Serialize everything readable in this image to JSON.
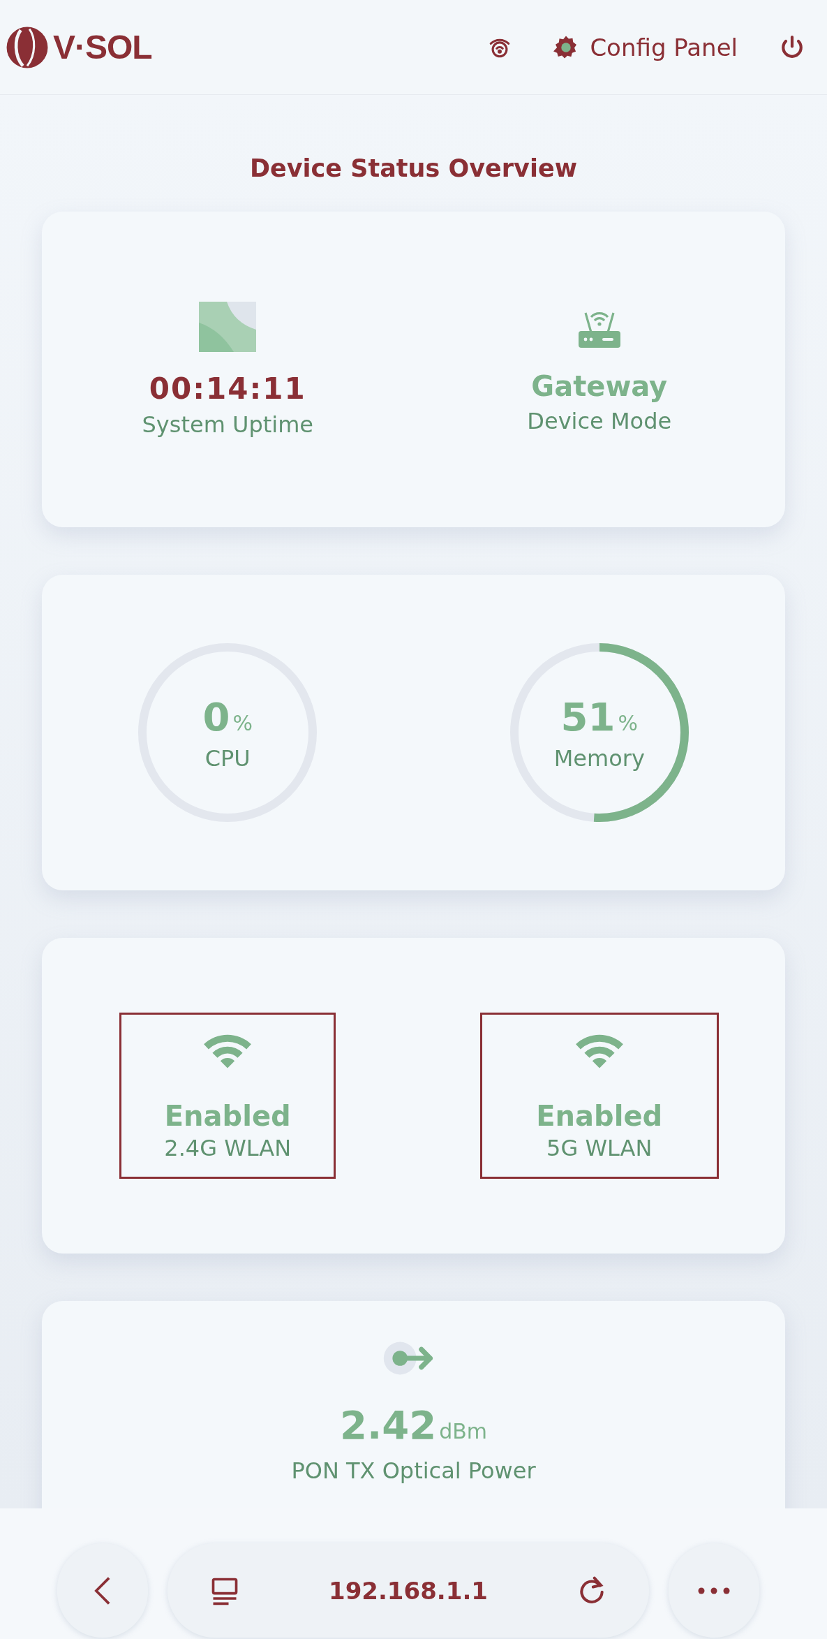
{
  "header": {
    "brand": "V·SOL",
    "config_label": "Config Panel"
  },
  "page_title": "Device Status Overview",
  "info_card": {
    "items": [
      {
        "kind": "uptime",
        "value": "00:14:11",
        "label": "System Uptime"
      },
      {
        "kind": "mode",
        "value": "Gateway",
        "label": "Device Mode"
      }
    ]
  },
  "usage_card": {
    "gauges": [
      {
        "value": "0",
        "unit": "%",
        "label": "CPU",
        "level": 0
      },
      {
        "value": "51",
        "unit": "%",
        "label": "Memory",
        "level": 0.51
      }
    ]
  },
  "wlan_card": {
    "items": [
      {
        "status": "Enabled",
        "label": "2.4G WLAN",
        "highlighted": true
      },
      {
        "status": "Enabled",
        "label": "5G WLAN",
        "highlighted": true
      }
    ]
  },
  "optical_card": {
    "value": "2.42",
    "unit": "dBm",
    "label": "PON TX Optical Power"
  },
  "browser_bar": {
    "url": "192.168.1.1"
  }
}
